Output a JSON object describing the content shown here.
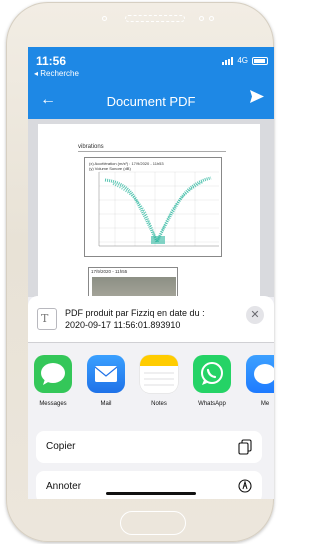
{
  "status_bar": {
    "time": "11:56",
    "back_app": "◂ Recherche",
    "network": "4G"
  },
  "nav": {
    "title": "Document PDF"
  },
  "document": {
    "heading": "vibrations",
    "chart_legend": [
      "(x) Accélération (m/s²)    : 17/9/2020 - 11h53",
      "(y) Volume Sonore (dB)"
    ],
    "photo_caption": "17/9/2020 - 11h55"
  },
  "share": {
    "title": "PDF produit par Fizziq en date du : 2020-09-17 11:56:01.893910",
    "apps": [
      {
        "label": "Messages",
        "icon": "messages-icon",
        "color": "#34c759"
      },
      {
        "label": "Mail",
        "icon": "mail-icon",
        "color": "#1f8cf5"
      },
      {
        "label": "Notes",
        "icon": "notes-icon",
        "color": "#ffcc00"
      },
      {
        "label": "WhatsApp",
        "icon": "whatsapp-icon",
        "color": "#25d366"
      },
      {
        "label": "Me",
        "icon": "messenger-icon",
        "color": "#1e7bff"
      }
    ],
    "actions": [
      {
        "label": "Copier",
        "icon": "copy-icon"
      },
      {
        "label": "Annoter",
        "icon": "markup-icon"
      }
    ]
  },
  "colors": {
    "header": "#1e88e5",
    "sheet": "#f2f2f5"
  }
}
